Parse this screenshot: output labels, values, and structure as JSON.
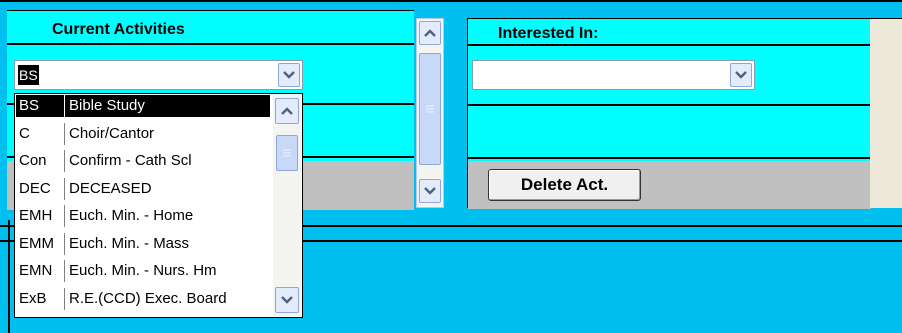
{
  "current_activities": {
    "header": "Current Activities",
    "combo_value": "BS",
    "list_items": [
      {
        "code": "BS",
        "description": "Bible Study",
        "selected": true
      },
      {
        "code": "C",
        "description": "Choir/Cantor",
        "selected": false
      },
      {
        "code": "Con",
        "description": "Confirm - Cath Scl",
        "selected": false
      },
      {
        "code": "DEC",
        "description": "DECEASED",
        "selected": false
      },
      {
        "code": "EMH",
        "description": "Euch. Min. - Home",
        "selected": false
      },
      {
        "code": "EMM",
        "description": "Euch. Min. - Mass",
        "selected": false
      },
      {
        "code": "EMN",
        "description": "Euch. Min. - Nurs. Hm",
        "selected": false
      },
      {
        "code": "ExB",
        "description": "R.E.(CCD) Exec. Board",
        "selected": false
      }
    ]
  },
  "interested_in": {
    "header": "Interested In:",
    "combo_value": ""
  },
  "buttons": {
    "delete_act": "Delete Act."
  },
  "icons": {
    "scroll_up": "arrow-up-icon",
    "scroll_down": "arrow-down-icon",
    "dropdown": "chevron-down-icon",
    "grip": "scroll-grip-icon"
  },
  "colors": {
    "background": "#00c0f0",
    "panel_cyan": "#00ffff",
    "gray_bar": "#c0c0c0",
    "beige": "#ece9d8",
    "selection": "#000000"
  }
}
